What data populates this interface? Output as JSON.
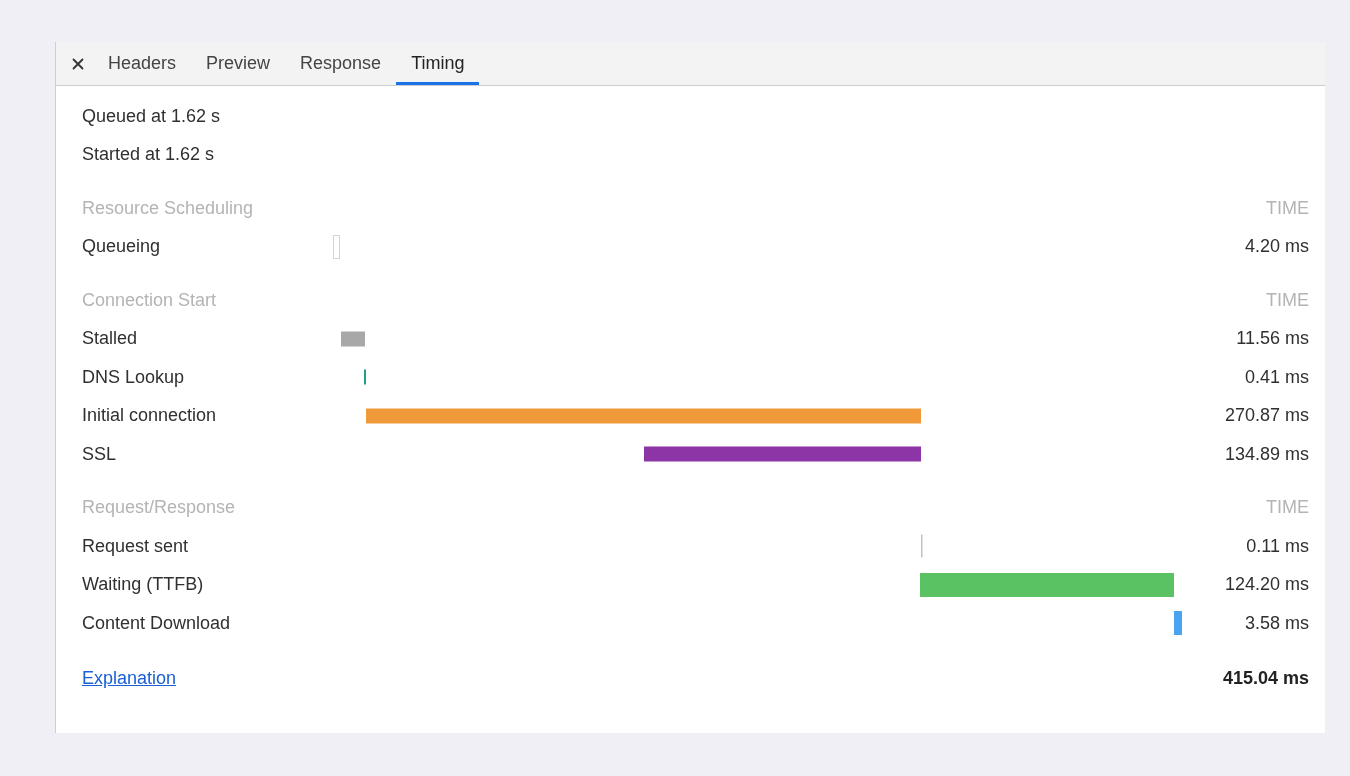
{
  "tabs": [
    {
      "label": "Headers",
      "selected": false
    },
    {
      "label": "Preview",
      "selected": false
    },
    {
      "label": "Response",
      "selected": false
    },
    {
      "label": "Timing",
      "selected": true
    }
  ],
  "summary": [
    "Queued at 1.62 s",
    "Started at 1.62 s"
  ],
  "sections": [
    {
      "title": "Resource Scheduling",
      "column_label": "TIME",
      "rows": [
        {
          "label": "Queueing",
          "time": "4.20 ms",
          "bar": {
            "kind": "outline",
            "color": "#d4d4d4"
          }
        }
      ]
    },
    {
      "title": "Connection Start",
      "column_label": "TIME",
      "rows": [
        {
          "label": "Stalled",
          "time": "11.56 ms",
          "bar": {
            "kind": "solid",
            "color": "#a8a8a8"
          }
        },
        {
          "label": "DNS Lookup",
          "time": "0.41 ms",
          "bar": {
            "kind": "solid",
            "color": "#1f9c8c"
          }
        },
        {
          "label": "Initial connection",
          "time": "270.87 ms",
          "bar": {
            "kind": "solid",
            "color": "#f09a3a"
          }
        },
        {
          "label": "SSL",
          "time": "134.89 ms",
          "bar": {
            "kind": "solid",
            "color": "#8d35a6"
          }
        }
      ]
    },
    {
      "title": "Request/Response",
      "column_label": "TIME",
      "rows": [
        {
          "label": "Request sent",
          "time": "0.11 ms",
          "bar": {
            "kind": "solid",
            "color": "#b9c4d0"
          }
        },
        {
          "label": "Waiting (TTFB)",
          "time": "124.20 ms",
          "bar": {
            "kind": "solid",
            "color": "#5ac262"
          }
        },
        {
          "label": "Content Download",
          "time": "3.58 ms",
          "bar": {
            "kind": "solid",
            "color": "#4aa3ee"
          }
        }
      ]
    }
  ],
  "footer": {
    "link": "Explanation",
    "total": "415.04 ms"
  }
}
